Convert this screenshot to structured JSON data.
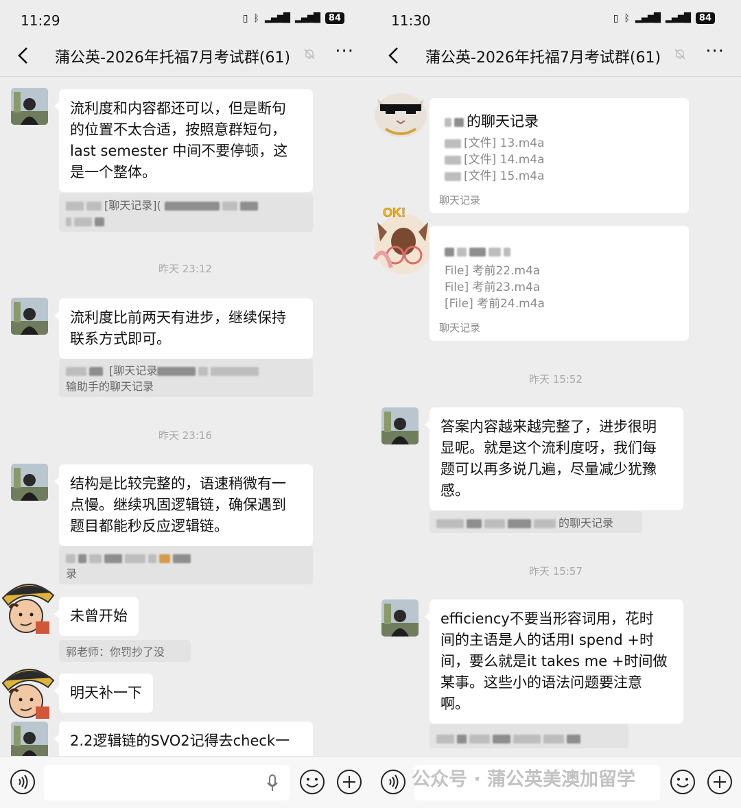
{
  "colors": {
    "background": "#ededed",
    "bubble": "#ffffff",
    "quote": "#e3e3e3",
    "timestamp": "#a8a8a8"
  },
  "left": {
    "time": "11:29",
    "battery": "84",
    "title": "蒲公英-2026年托福7月考试群(61)",
    "messages": [
      {
        "lines": [
          "流利度和内容都还可以，但是断句",
          "的位置不太合适，按照意群短句，",
          "last semester 中间不要停顿，这",
          "是一个整体。"
        ],
        "quote": "[聊天记录]("
      },
      {
        "lines": [
          "流利度比前两天有进步，继续保持",
          "联系方式即可。"
        ],
        "quote1": "[聊天记录",
        "quote2": "输助手的聊天记录"
      },
      {
        "lines": [
          "结构是比较完整的，语速稍微有一",
          "点慢。继续巩固逻辑链，确保遇到",
          "题目都能秒反应逻辑链。"
        ],
        "quote": "录"
      },
      {
        "lines": [
          "未曾开始"
        ],
        "quote": "郭老师：你罚抄了没"
      },
      {
        "lines": [
          "明天补一下"
        ]
      },
      {
        "lines": [
          "2.2逻辑链的SVO2记得去check一"
        ]
      }
    ],
    "timestamps": [
      "昨天 23:12",
      "昨天 23:16"
    ]
  },
  "right": {
    "time": "11:30",
    "battery": "84",
    "title": "蒲公英-2026年托福7月考试群(61)",
    "card1": {
      "title": "的聊天记录",
      "files": [
        "[文件] 13.m4a",
        "[文件] 14.m4a",
        "[文件] 15.m4a"
      ],
      "footer": "聊天记录"
    },
    "card2": {
      "files": [
        "File] 考前22.m4a",
        "File] 考前23.m4a",
        "[File] 考前24.m4a"
      ],
      "footer": "聊天记录"
    },
    "sticker_text": "OK!",
    "timestamps": [
      "昨天 15:52",
      "昨天 15:57"
    ],
    "messages": [
      {
        "lines": [
          "答案内容越来越完整了，进步很明",
          "显呢。就是这个流利度呀，我们每",
          "题可以再多说几遍，尽量减少犹豫",
          "感。"
        ],
        "quote": "的聊天记录"
      },
      {
        "lines": [
          "efficiency不要当形容词用，花时",
          "间的主语是人的话用I spend +时",
          "间，要么就是it takes me +时间做",
          "某事。这些小的语法问题要注意",
          "啊。"
        ]
      }
    ]
  },
  "watermark": "公众号 · 蒲公英美澳加留学"
}
